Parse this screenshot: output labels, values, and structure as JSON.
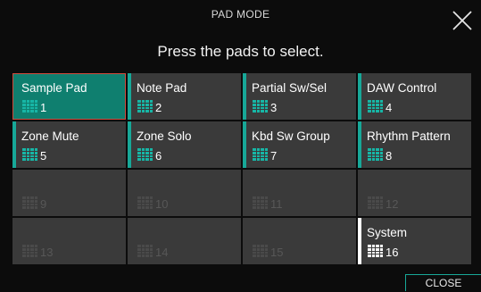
{
  "header": {
    "title": "PAD MODE"
  },
  "prompt": "Press the pads to select.",
  "pads": [
    {
      "label": "Sample Pad",
      "num": "1"
    },
    {
      "label": "Note Pad",
      "num": "2"
    },
    {
      "label": "Partial Sw/Sel",
      "num": "3"
    },
    {
      "label": "DAW Control",
      "num": "4"
    },
    {
      "label": "Zone Mute",
      "num": "5"
    },
    {
      "label": "Zone Solo",
      "num": "6"
    },
    {
      "label": "Kbd Sw Group",
      "num": "7"
    },
    {
      "label": "Rhythm Pattern",
      "num": "8"
    },
    {
      "label": "",
      "num": "9"
    },
    {
      "label": "",
      "num": "10"
    },
    {
      "label": "",
      "num": "11"
    },
    {
      "label": "",
      "num": "12"
    },
    {
      "label": "",
      "num": "13"
    },
    {
      "label": "",
      "num": "14"
    },
    {
      "label": "",
      "num": "15"
    },
    {
      "label": "System",
      "num": "16"
    }
  ],
  "selected_pad": "1",
  "footer": {
    "close_label": "CLOSE"
  },
  "colors": {
    "accent": "#17a898",
    "selected_bg": "#0f7f6f",
    "selected_border": "#d24a3c",
    "pad_bg": "#3a3a3a"
  },
  "icons": {
    "close": "close-x-icon",
    "pad_grid": "pad-grid-icon"
  }
}
